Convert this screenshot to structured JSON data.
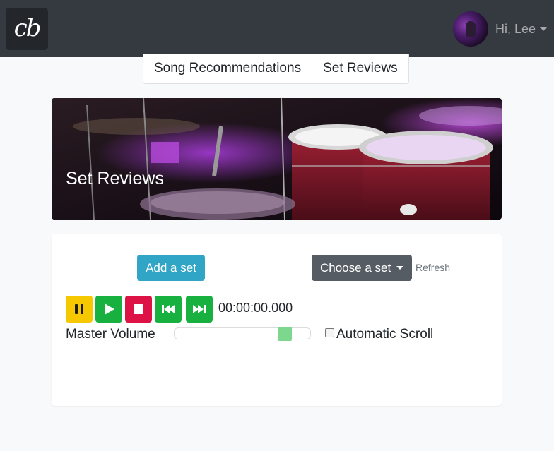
{
  "navbar": {
    "brand": "cb",
    "greeting": "Hi, Lee",
    "icons": {
      "avatar": "user-avatar",
      "caret": "caret-down-icon"
    }
  },
  "tabs": [
    {
      "label": "Song Recommendations"
    },
    {
      "label": "Set Reviews"
    }
  ],
  "hero": {
    "title": "Set Reviews",
    "image": "drum-kit-photo"
  },
  "controls": {
    "add_set": "Add a set",
    "choose_set": "Choose a set",
    "refresh": "Refresh",
    "time": "00:00:00.000",
    "master_volume_label": "Master Volume",
    "master_volume_level": 0.85,
    "auto_scroll_label": "Automatic Scroll",
    "auto_scroll_checked": false,
    "icons": [
      "pause-icon",
      "play-icon",
      "stop-icon",
      "skip-back-icon",
      "skip-forward-icon"
    ]
  },
  "colors": {
    "navbar": "#343a40",
    "add_button": "#31a5c6",
    "choose_button": "#565c63",
    "pause": "#f6c800",
    "play": "#18b140",
    "stop": "#dc1344",
    "volume_thumb": "#7dd88d"
  }
}
